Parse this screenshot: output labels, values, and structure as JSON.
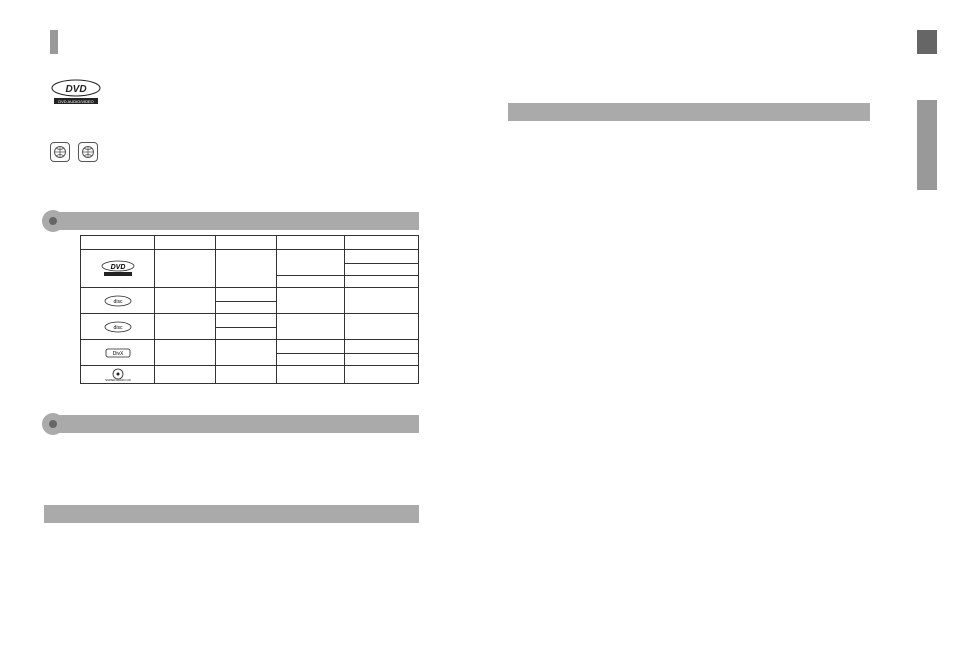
{
  "page": {
    "top_left_marker": "",
    "top_right_marker": ""
  },
  "logos": {
    "dvd_main": "DVD AUDIO/VIDEO",
    "icon_1": "globe",
    "icon_2": "globe"
  },
  "bars": {
    "bar1_label": "",
    "bar2_label": "",
    "bar3_label": "",
    "bar4_label": ""
  },
  "table": {
    "headers": [
      "",
      "",
      "",
      "",
      ""
    ],
    "rows": [
      {
        "logo": "DVD",
        "c2": "",
        "c3": "",
        "c4a": "",
        "c4b": "",
        "c4c": ""
      },
      {
        "logo": "disc1",
        "c2": "",
        "c3a": "",
        "c3b": "",
        "c4": ""
      },
      {
        "logo": "disc2",
        "c2": "",
        "c3a": "",
        "c3b": "",
        "c4": ""
      },
      {
        "logo": "DivX",
        "c2": "",
        "c3": "",
        "c4a": "",
        "c4b": ""
      },
      {
        "logo": "SACD",
        "c2": "",
        "c3": "",
        "c4": ""
      }
    ]
  }
}
